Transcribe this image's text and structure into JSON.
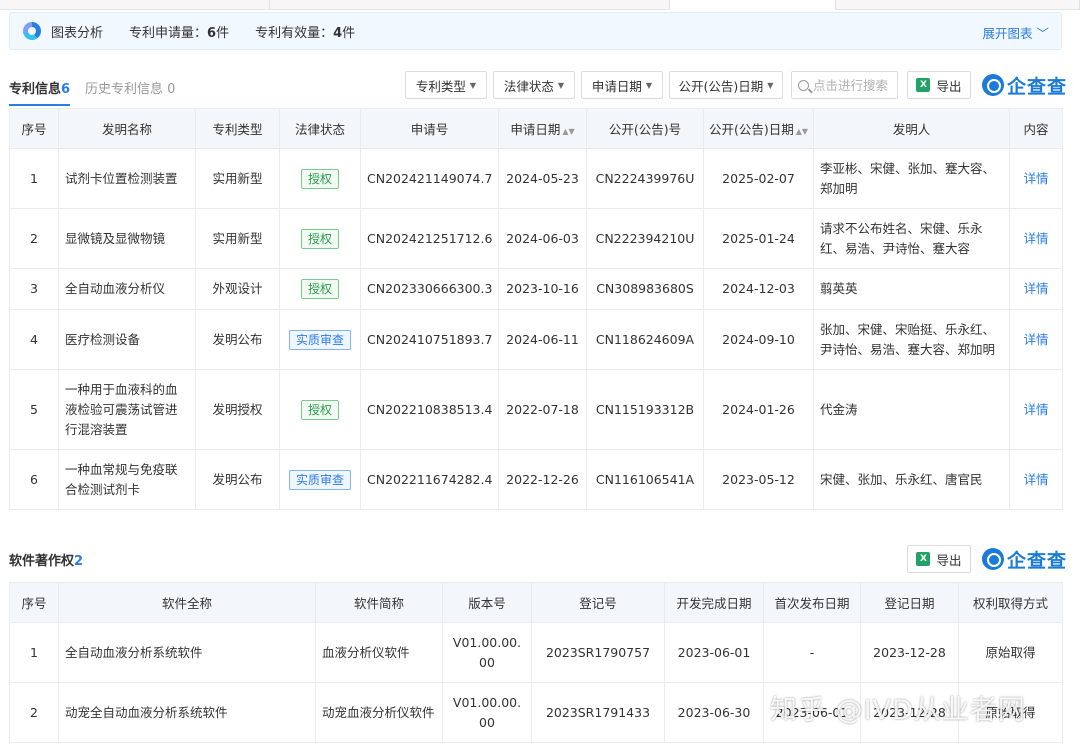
{
  "summary": {
    "title": "图表分析",
    "apply_label": "专利申请量：",
    "apply_count": "6",
    "apply_unit": "件",
    "valid_label": "专利有效量：",
    "valid_count": "4",
    "valid_unit": "件",
    "expand": "展开图表 ﹀"
  },
  "patent_tabs": {
    "active_label": "专利信息",
    "active_count": "6",
    "inactive": "历史专利信息 0"
  },
  "toolbar": {
    "filter_type": "专利类型",
    "filter_status": "法律状态",
    "filter_apply_date": "申请日期",
    "filter_pub_date": "公开(公告)日期",
    "search_placeholder": "点击进行搜索",
    "export": "导出",
    "brand": "企查查"
  },
  "patent_table": {
    "headers": [
      "序号",
      "发明名称",
      "专利类型",
      "法律状态",
      "申请号",
      "申请日期",
      "公开(公告)号",
      "公开(公告)日期",
      "发明人",
      "内容"
    ],
    "rows": [
      {
        "no": "1",
        "name": "试剂卡位置检测装置",
        "type": "实用新型",
        "status": "授权",
        "status_color": "green",
        "app_no": "CN202421149074.7",
        "app_date": "2024-05-23",
        "pub_no": "CN222439976U",
        "pub_date": "2025-02-07",
        "inventors": "李亚彬、宋健、张加、蹇大容、郑加明",
        "detail": "详情"
      },
      {
        "no": "2",
        "name": "显微镜及显微物镜",
        "type": "实用新型",
        "status": "授权",
        "status_color": "green",
        "app_no": "CN202421251712.6",
        "app_date": "2024-06-03",
        "pub_no": "CN222394210U",
        "pub_date": "2025-01-24",
        "inventors": "请求不公布姓名、宋健、乐永红、易浩、尹诗怡、蹇大容",
        "detail": "详情"
      },
      {
        "no": "3",
        "name": "全自动血液分析仪",
        "type": "外观设计",
        "status": "授权",
        "status_color": "green",
        "app_no": "CN202330666300.3",
        "app_date": "2023-10-16",
        "pub_no": "CN308983680S",
        "pub_date": "2024-12-03",
        "inventors": "翦英英",
        "detail": "详情"
      },
      {
        "no": "4",
        "name": "医疗检测设备",
        "type": "发明公布",
        "status": "实质审查",
        "status_color": "blue",
        "app_no": "CN202410751893.7",
        "app_date": "2024-06-11",
        "pub_no": "CN118624609A",
        "pub_date": "2024-09-10",
        "inventors": "张加、宋健、宋贻挺、乐永红、尹诗怡、易浩、蹇大容、郑加明",
        "detail": "详情"
      },
      {
        "no": "5",
        "name": "一种用于血液科的血液检验可震荡试管进行混溶装置",
        "type": "发明授权",
        "status": "授权",
        "status_color": "green",
        "app_no": "CN202210838513.4",
        "app_date": "2022-07-18",
        "pub_no": "CN115193312B",
        "pub_date": "2024-01-26",
        "inventors": "代金涛",
        "detail": "详情"
      },
      {
        "no": "6",
        "name": "一种血常规与免疫联合检测试剂卡",
        "type": "发明公布",
        "status": "实质审查",
        "status_color": "blue",
        "app_no": "CN202211674282.4",
        "app_date": "2022-12-26",
        "pub_no": "CN116106541A",
        "pub_date": "2023-05-12",
        "inventors": "宋健、张加、乐永红、唐官民",
        "detail": "详情"
      }
    ]
  },
  "software": {
    "title": "软件著作权",
    "count": "2",
    "export": "导出",
    "brand": "企查查",
    "headers": [
      "序号",
      "软件全称",
      "软件简称",
      "版本号",
      "登记号",
      "开发完成日期",
      "首次发布日期",
      "登记日期",
      "权利取得方式"
    ],
    "rows": [
      {
        "no": "1",
        "full": "全自动血液分析系统软件",
        "short": "血液分析仪软件",
        "version": "V01.00.00.00",
        "reg_no": "2023SR1790757",
        "dev_date": "2023-06-01",
        "pub_date": "-",
        "reg_date": "2023-12-28",
        "method": "原始取得"
      },
      {
        "no": "2",
        "full": "动宠全自动血液分析系统软件",
        "short": "动宠血液分析仪软件",
        "version": "V01.00.00.00",
        "reg_no": "2023SR1791433",
        "dev_date": "2023-06-30",
        "pub_date": "2023-06-01",
        "reg_date": "2023-12-28",
        "method": "原始取得"
      }
    ]
  },
  "watermark": "知乎 @IVD从业者网"
}
